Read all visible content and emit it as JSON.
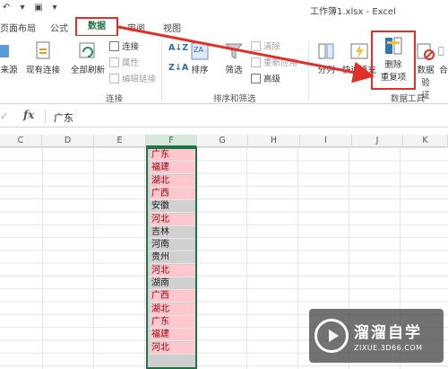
{
  "window": {
    "title": "工作簿1.xlsx - Excel"
  },
  "tabs": {
    "items": [
      "页面布局",
      "公式",
      "数据",
      "审阅",
      "视图"
    ],
    "active": "数据"
  },
  "ribbon": {
    "get_external": "来源",
    "existing_connections": "现有连接",
    "refresh_all": "全部刷新",
    "connections": "连接",
    "properties": "属性",
    "edit_links": "编辑链接",
    "connections_group": "连接",
    "sort_az_icon": "A↓Z",
    "sort_za_icon": "Z↓A",
    "sort": "排序",
    "filter": "筛选",
    "clear": "清除",
    "reapply": "重新应用",
    "advanced": "高级",
    "sort_filter_group": "排序和筛选",
    "text_to_columns": "分列",
    "flash_fill": "快速填充",
    "remove_duplicates_line1": "删除",
    "remove_duplicates_line2": "重复项",
    "data_validation_line1": "数据验",
    "data_validation_line2": "证",
    "consolidate": "合",
    "data_tools_group": "数据工具"
  },
  "formula_bar": {
    "cancel_icon": "close-icon",
    "fx": "fx",
    "value": "广东"
  },
  "sheet": {
    "columns": [
      "C",
      "D",
      "E",
      "F",
      "G",
      "H",
      "I",
      "J",
      "K"
    ],
    "selected_column": "F",
    "cells": [
      {
        "text": "广东",
        "dup": true
      },
      {
        "text": "福建",
        "dup": true
      },
      {
        "text": "湖北",
        "dup": true
      },
      {
        "text": "广西",
        "dup": true
      },
      {
        "text": "安徽",
        "dup": false
      },
      {
        "text": "河北",
        "dup": true
      },
      {
        "text": "吉林",
        "dup": false
      },
      {
        "text": "河南",
        "dup": false
      },
      {
        "text": "贵州",
        "dup": false
      },
      {
        "text": "河北",
        "dup": true
      },
      {
        "text": "湖南",
        "dup": false
      },
      {
        "text": "广西",
        "dup": true
      },
      {
        "text": "湖北",
        "dup": true
      },
      {
        "text": "广东",
        "dup": true
      },
      {
        "text": "福建",
        "dup": true
      },
      {
        "text": "河北",
        "dup": true
      }
    ]
  },
  "watermark": {
    "name": "溜溜自学",
    "url": "ZIXUE.3D66.COM"
  },
  "colors": {
    "excel_green": "#217346",
    "highlight_red": "#e0302a",
    "dup_fill": "#ffc7ce",
    "dup_text": "#9c0006"
  }
}
